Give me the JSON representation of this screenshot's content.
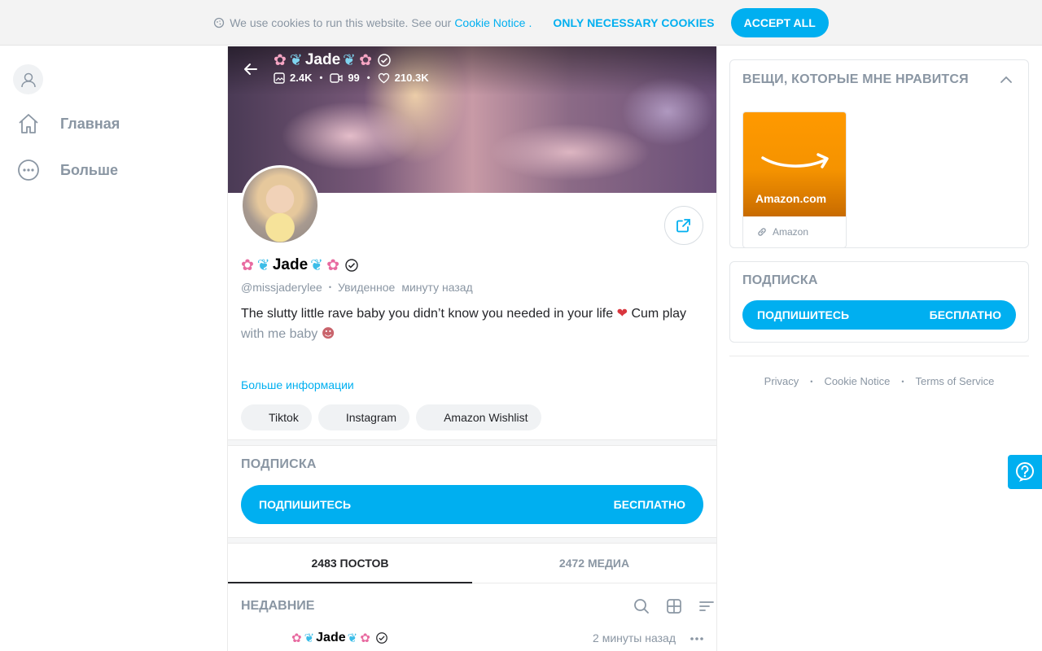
{
  "cookie_bar": {
    "text": "We use cookies to run this website. See our",
    "link": "Cookie Notice",
    "trailing": ".",
    "necessary_label": "ONLY NECESSARY COOKIES",
    "accept_label": "ACCEPT ALL"
  },
  "sidebar": {
    "items": [
      {
        "label": "Главная",
        "icon": "home-icon"
      },
      {
        "label": "Больше",
        "icon": "more-circle-icon"
      }
    ]
  },
  "banner": {
    "name": "Jade",
    "stats": {
      "photos": "2.4K",
      "videos": "99",
      "likes": "210.3K"
    }
  },
  "profile": {
    "name": "Jade",
    "handle": "@missjaderylee",
    "seen_label": "Увиденное",
    "seen_time": "минуту назад",
    "bio_line1": "The slutty little rave baby you didn’t know you needed in your life",
    "bio_line1_end": "Cum play",
    "bio_line2": "with me baby",
    "more_info": "Больше информации",
    "links": [
      "Tiktok",
      "Instagram",
      "Amazon Wishlist"
    ]
  },
  "subscription": {
    "title": "ПОДПИСКА",
    "button_left": "ПОДПИШИТЕСЬ",
    "button_right": "БЕСПЛАТНО"
  },
  "tabs": [
    {
      "label": "2483 ПОСТОВ",
      "active": true
    },
    {
      "label": "2472 МЕДИА",
      "active": false
    }
  ],
  "recent": {
    "title": "НЕДАВНИЕ",
    "post_author": "Jade",
    "post_time": "2 минуты назад"
  },
  "right": {
    "likes_title": "ВЕЩИ, КОТОРЫЕ МНЕ НРАВИТСЯ",
    "amazon_name": "Amazon.com",
    "amazon_caption": "Amazon",
    "sub_title": "ПОДПИСКА",
    "sub_left": "ПОДПИШИТЕСЬ",
    "sub_right": "БЕСПЛАТНО"
  },
  "footer": {
    "privacy": "Privacy",
    "cookie": "Cookie Notice",
    "terms": "Terms of Service"
  },
  "colors": {
    "accent": "#00aff0",
    "muted": "#8a96a3",
    "text": "#242529"
  }
}
